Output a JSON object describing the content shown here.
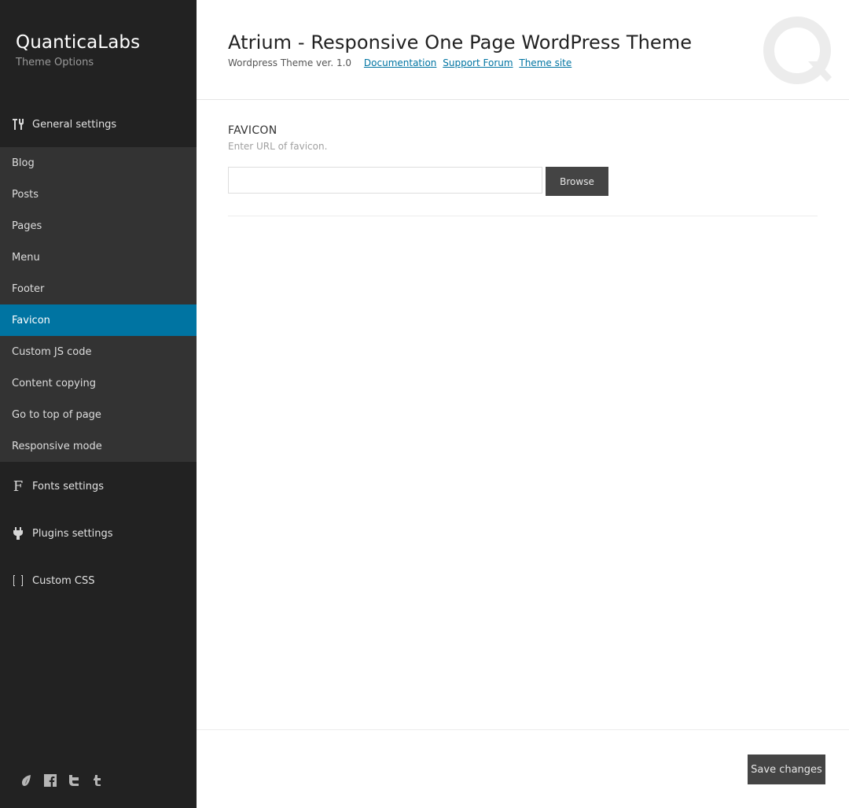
{
  "brand": {
    "title": "QuanticaLabs",
    "subtitle": "Theme Options"
  },
  "sidebar": {
    "sections": [
      {
        "label": "General settings",
        "icon": "tools-icon"
      },
      {
        "label": "Fonts settings",
        "icon": "font-icon"
      },
      {
        "label": "Plugins settings",
        "icon": "plug-icon"
      },
      {
        "label": "Custom CSS",
        "icon": "braces-icon"
      }
    ],
    "sub_items": [
      {
        "label": "Blog"
      },
      {
        "label": "Posts"
      },
      {
        "label": "Pages"
      },
      {
        "label": "Menu"
      },
      {
        "label": "Footer"
      },
      {
        "label": "Favicon",
        "active": true
      },
      {
        "label": "Custom JS code"
      },
      {
        "label": "Content copying"
      },
      {
        "label": "Go to top of page"
      },
      {
        "label": "Responsive mode"
      }
    ],
    "social": [
      "envato-icon",
      "facebook-icon",
      "twitter-icon",
      "tumblr-icon"
    ]
  },
  "header": {
    "title": "Atrium - Responsive One Page WordPress Theme",
    "version": "Wordpress Theme ver. 1.0",
    "links": [
      "Documentation",
      "Support Forum",
      "Theme site"
    ]
  },
  "field": {
    "title": "FAVICON",
    "description": "Enter URL of favicon.",
    "value": "",
    "browse_label": "Browse"
  },
  "footer": {
    "save_label": "Save changes"
  },
  "colors": {
    "sidebar_bg": "#222222",
    "submenu_bg": "#333333",
    "active_bg": "#0074a2",
    "link": "#0074a2",
    "button_bg": "#444444"
  }
}
